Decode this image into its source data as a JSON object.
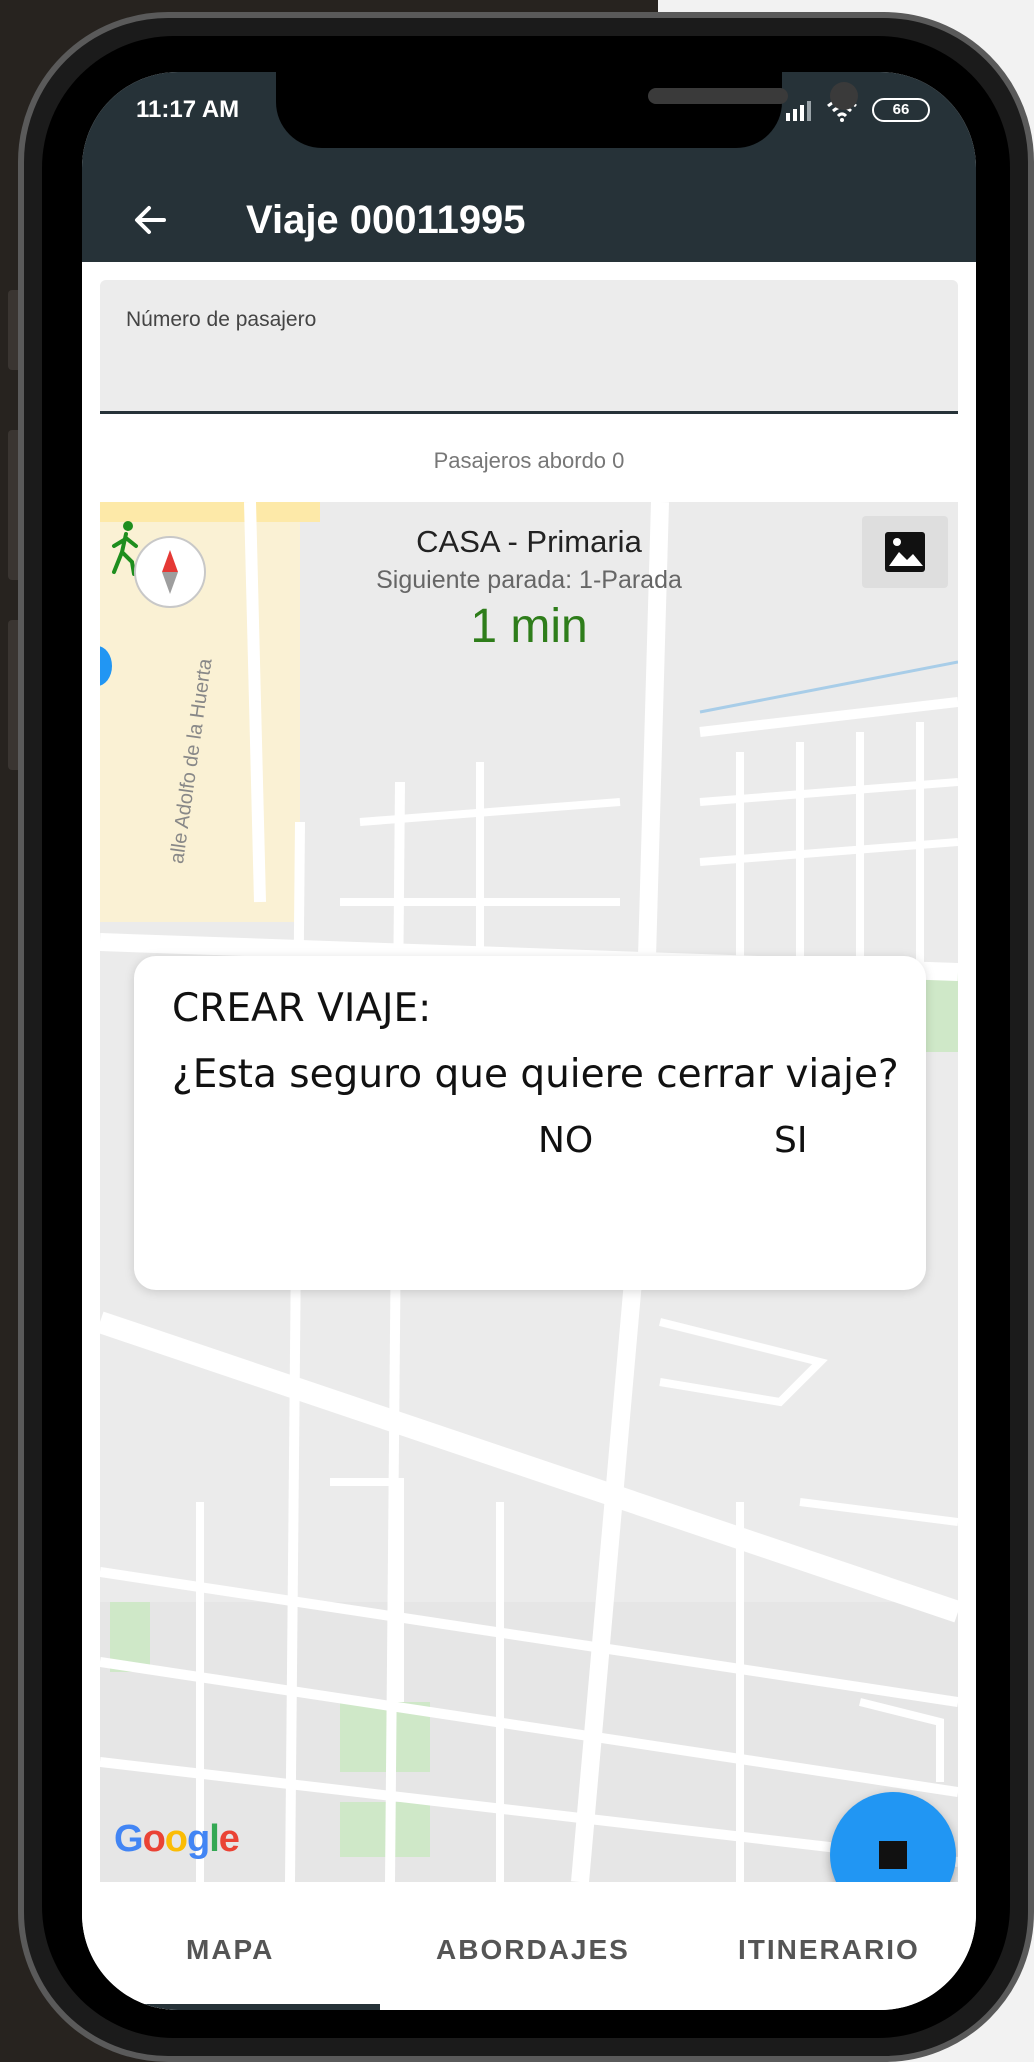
{
  "status_bar": {
    "time": "11:17 AM",
    "battery": "66"
  },
  "app_bar": {
    "title": "Viaje 00011995",
    "back_icon": "arrow-left-icon"
  },
  "passenger_field": {
    "label": "Número de pasajero",
    "value": ""
  },
  "aboard_text": "Pasajeros abordo 0",
  "map": {
    "route_name": "CASA - Primaria",
    "next_stop": "Siguiente parada: 1-Parada",
    "eta": "1 min",
    "street_label": "alle Adolfo de la Huerta",
    "logo": "Google",
    "icons": [
      "walking-person-icon",
      "compass-icon",
      "map-type-icon",
      "location-dot-icon",
      "stop-icon"
    ]
  },
  "dialog": {
    "title": "CREAR VIAJE:",
    "message": "¿Esta seguro que quiere cerrar viaje?",
    "no_label": "NO",
    "yes_label": "SI"
  },
  "tabs": [
    {
      "label": "MAPA",
      "selected": true
    },
    {
      "label": "ABORDAJES",
      "selected": false
    },
    {
      "label": "ITINERARIO",
      "selected": false
    }
  ],
  "colors": {
    "app_bar": "#263238",
    "eta": "#2e7d1a",
    "fab": "#2196f3"
  }
}
